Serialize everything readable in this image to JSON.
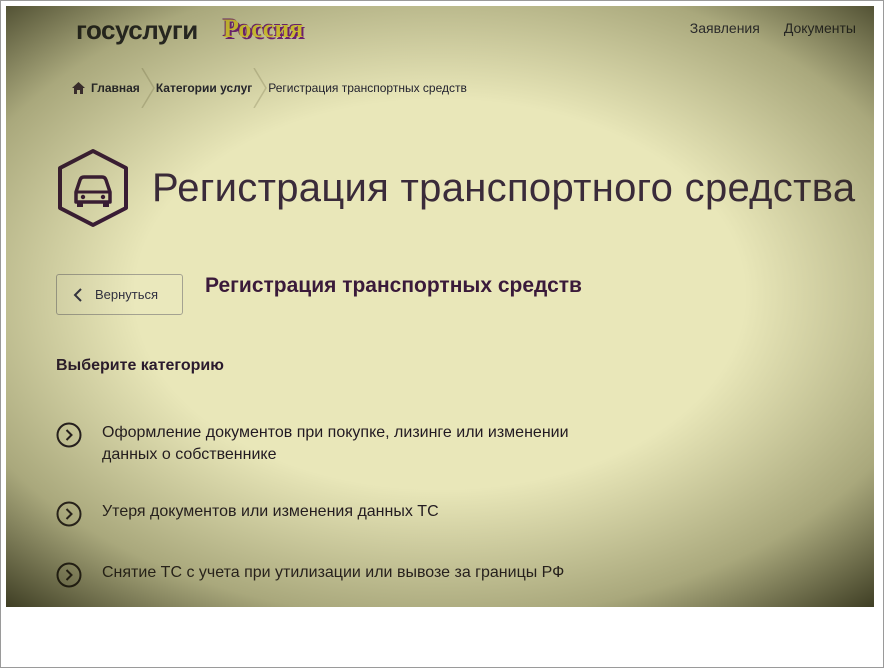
{
  "header": {
    "logo": "госуслуги",
    "logo_suffix": "Россия",
    "nav": [
      "Заявления",
      "Документы"
    ]
  },
  "breadcrumb": {
    "items": [
      "Главная",
      "Категории услуг",
      "Регистрация транспортных средств"
    ]
  },
  "page": {
    "icon": "car-icon",
    "title": "Регистрация транспортного средства"
  },
  "back_button": {
    "label": "Вернуться",
    "icon": "chevron-left-icon"
  },
  "section": {
    "title": "Регистрация транспортных средств"
  },
  "categories": {
    "heading": "Выберите категорию",
    "items": [
      "Оформление документов при покупке, лизинге или изменении данных о собственнике",
      "Утеря документов или изменения данных ТС",
      "Снятие ТС с учета при утилизации или вывозе за границы РФ"
    ]
  },
  "colors": {
    "background": "#e9e7b9",
    "text": "#221a22",
    "logo_suffix": "#f4e03c",
    "logo_suffix_shadow": "#7a1b8a"
  }
}
